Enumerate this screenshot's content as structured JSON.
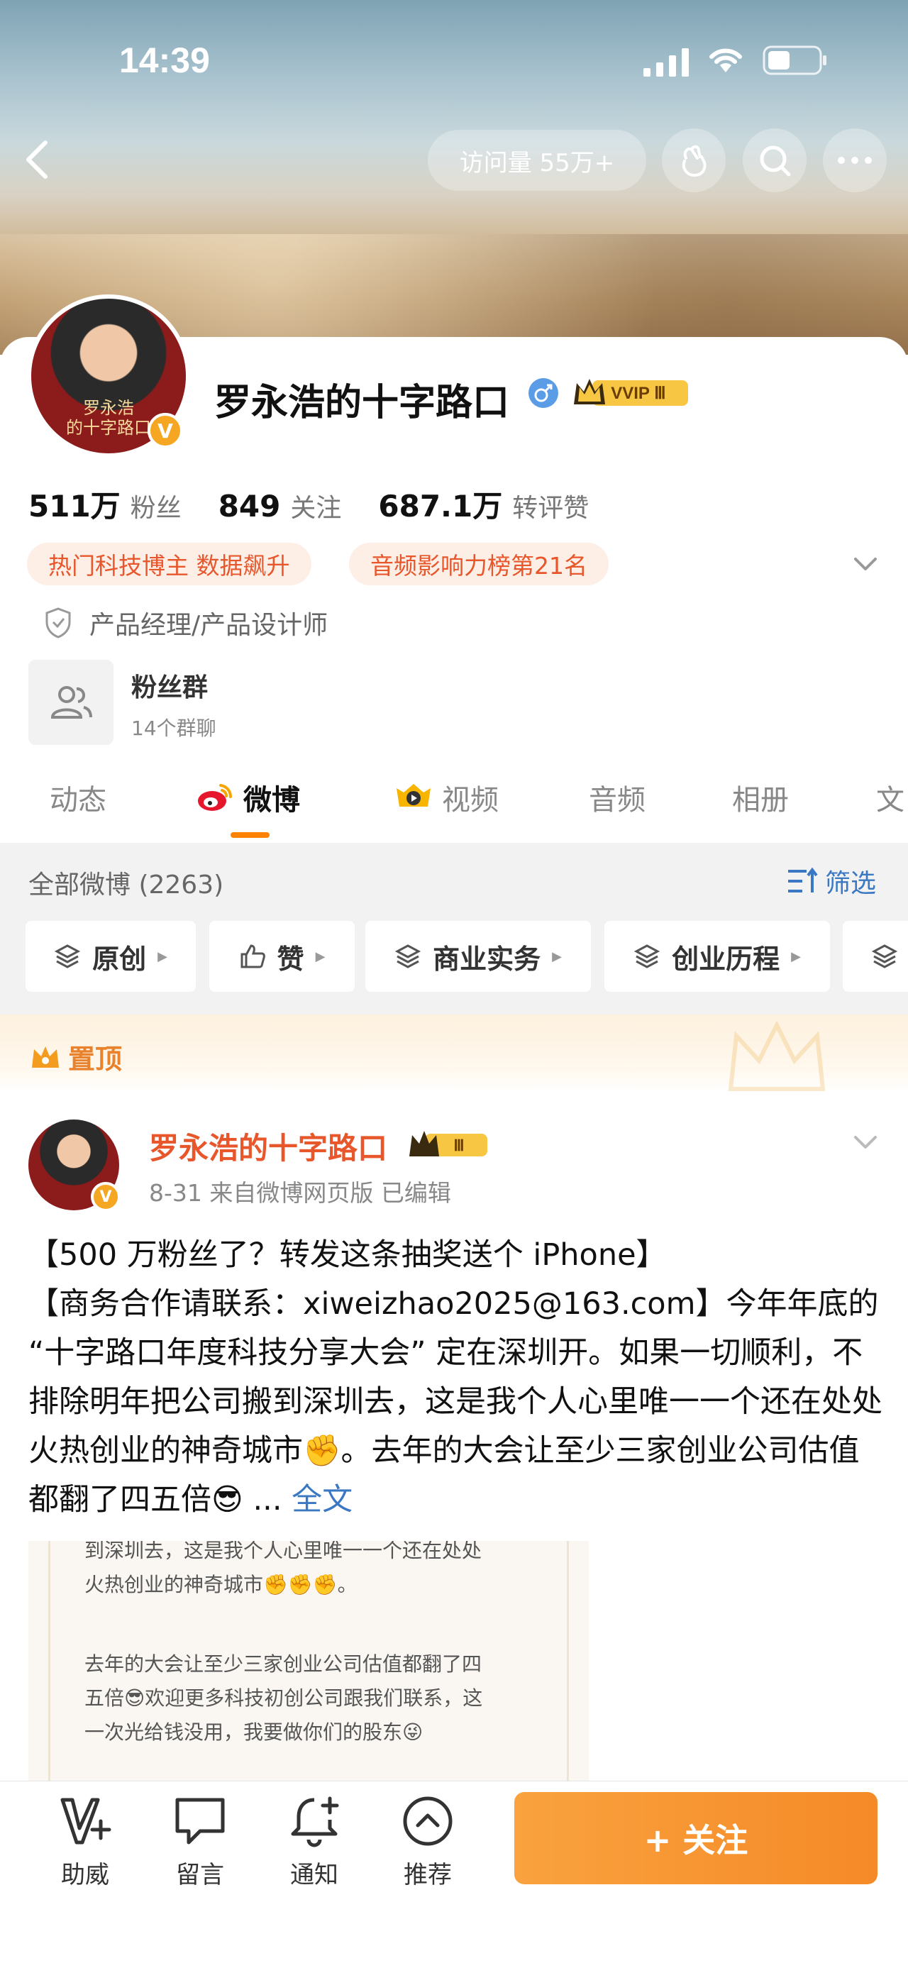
{
  "status": {
    "time": "14:39"
  },
  "header": {
    "visits": "访问量 55万+"
  },
  "profile": {
    "name": "罗永浩的十字路口",
    "avatar_caption": "罗永浩\n的十字路口",
    "vip_label": "VVIP Ⅲ",
    "stats": [
      {
        "num": "511万",
        "label": "粉丝"
      },
      {
        "num": "849",
        "label": "关注"
      },
      {
        "num": "687.1万",
        "label": "转评赞"
      }
    ],
    "tags": [
      "热门科技博主 数据飙升",
      "音频影响力榜第21名"
    ],
    "job": "产品经理/产品设计师",
    "fans_group": {
      "title": "粉丝群",
      "sub": "14个群聊"
    }
  },
  "tabs": [
    "动态",
    "微博",
    "视频",
    "音频",
    "相册",
    "文"
  ],
  "filter": {
    "count": "全部微博 (2263)",
    "filter_label": "筛选",
    "chips": [
      "原创",
      "赞",
      "商业实务",
      "创业历程"
    ]
  },
  "pinned": {
    "label": "置顶"
  },
  "post": {
    "author": "罗永浩的十字路口",
    "badge": "Ⅲ",
    "meta": "8-31  来自微博网页版  已编辑",
    "line1": "【500 万粉丝了？转发这条抽奖送个 iPhone】",
    "line2": "【商务合作请联系：xiweizhao2025@163.com】今年年底的 “十字路口年度科技分享大会” 定在深圳开。如果一切顺利，不排除明年把公司搬到深圳去，这是我个人心里唯一一个还在处处火热创业的神奇城市",
    "line3": "。去年的大会让至少三家创业公司估值都翻了四五倍",
    "ellipsis": " ... ",
    "more": "全文",
    "image_text": [
      "到深圳去，这是我个人心里唯一一个还在处处",
      "火热创业的神奇城市✊✊✊。",
      "",
      "去年的大会让至少三家创业公司估值都翻了四",
      "五倍😎欢迎更多科技初创公司跟我们联系，这",
      "一次光给钱没用，我要做你们的股东😜"
    ]
  },
  "bottom": {
    "items": [
      "助威",
      "留言",
      "通知",
      "推荐"
    ],
    "follow": "+ 关注"
  },
  "colors": {
    "accent": "#ff8200",
    "link": "#3b78c4",
    "name_orange": "#e8572c"
  }
}
